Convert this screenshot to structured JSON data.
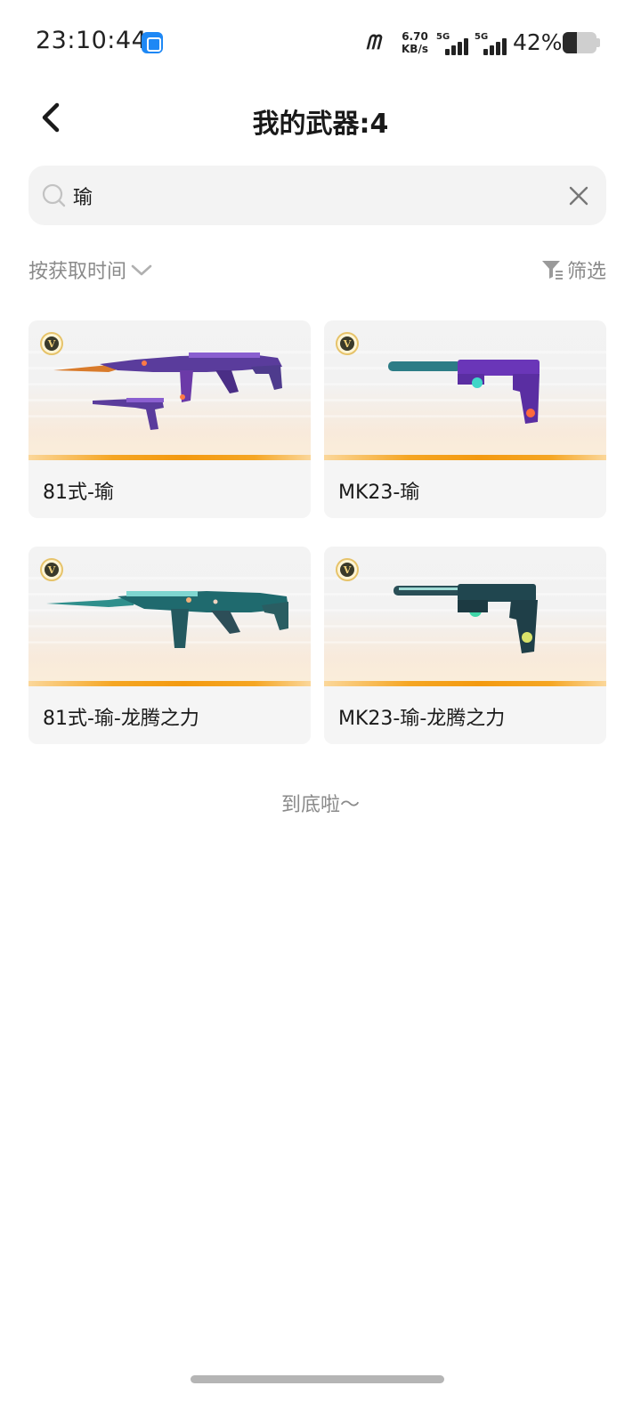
{
  "status_bar": {
    "time": "23:10:44",
    "carrier_logo": "ᗰ",
    "net_speed_value": "6.70",
    "net_speed_unit": "KB/s",
    "sim1_label": "5G",
    "sim2_label": "5G",
    "battery_percent": "42%",
    "battery_level": 0.42
  },
  "header": {
    "back_icon": "chevron-left-icon",
    "title": "我的武器:4"
  },
  "search": {
    "icon": "search-icon",
    "value": "瑜",
    "clear_icon": "close-icon"
  },
  "sort": {
    "label": "按获取时间",
    "icon": "chevron-down-icon"
  },
  "filter": {
    "label": "筛选",
    "icon": "filter-icon"
  },
  "weapons": [
    {
      "name": "81式-瑜",
      "badge": "V"
    },
    {
      "name": "MK23-瑜",
      "badge": "V"
    },
    {
      "name": "81式-瑜-龙腾之力",
      "badge": "V"
    },
    {
      "name": "MK23-瑜-龙腾之力",
      "badge": "V"
    }
  ],
  "end_message": "到底啦～",
  "colors": {
    "accent_orange": "#f5a623",
    "muted_text": "#8a8a8a",
    "search_bg": "#f3f3f3",
    "card_bg": "#f5f5f5"
  }
}
